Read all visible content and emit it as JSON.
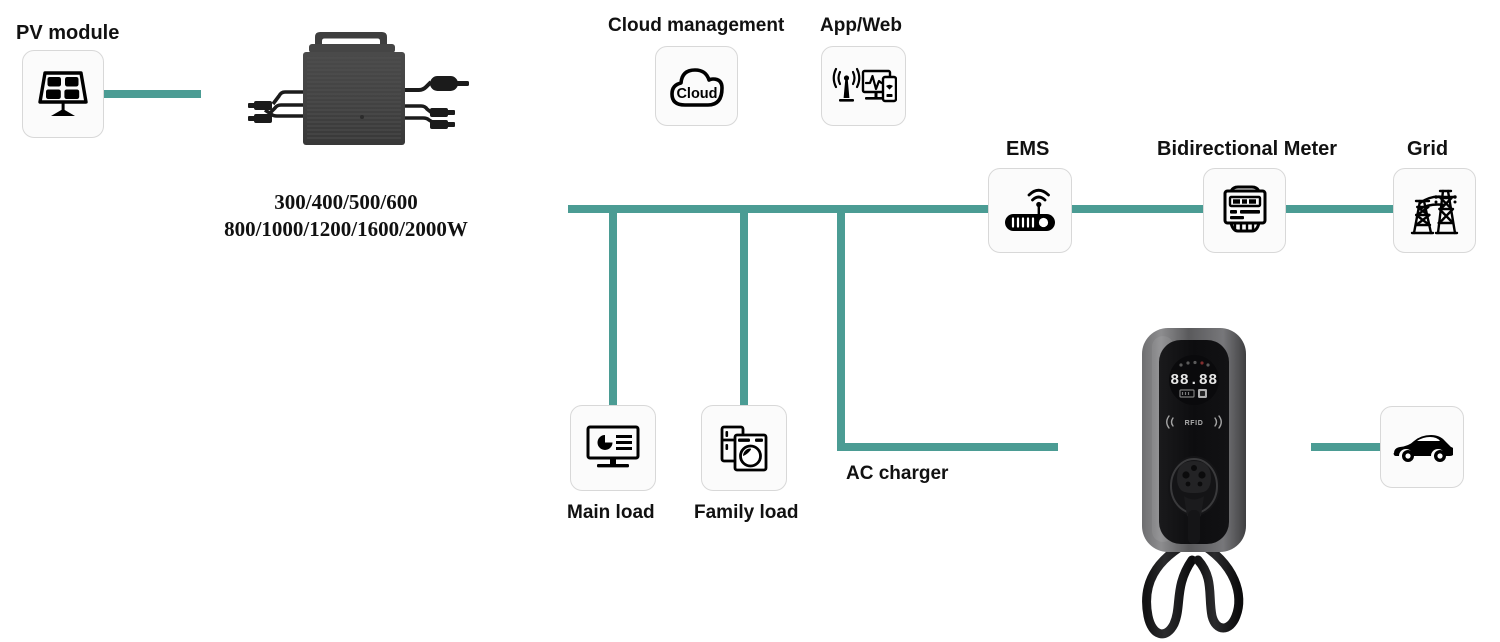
{
  "diagram": {
    "title": "Micro-inverter PV and EV charging system overview",
    "accent_color": "#4b9c94",
    "tile_bg": "#fbfbfb",
    "tile_border": "#d8d8d8"
  },
  "nodes": {
    "pv_module": {
      "label": "PV module",
      "icon": "solar-panel-icon"
    },
    "microinverter": {
      "icon": "microinverter-device",
      "spec_line1": "300/400/500/600",
      "spec_line2": "800/1000/1200/1600/2000W"
    },
    "cloud_management": {
      "label": "Cloud management",
      "icon": "cloud-icon",
      "icon_text": "Cloud"
    },
    "app_web": {
      "label": "App/Web",
      "icon": "signal-monitor-phone-icon"
    },
    "ems": {
      "label": "EMS",
      "icon": "router-wifi-icon"
    },
    "bidirectional_meter": {
      "label": "Bidirectional Meter",
      "icon": "energy-meter-icon"
    },
    "grid": {
      "label": "Grid",
      "icon": "transmission-tower-icon"
    },
    "main_load": {
      "label": "Main load",
      "icon": "monitor-chart-icon"
    },
    "family_load": {
      "label": "Family load",
      "icon": "fridge-washer-icon"
    },
    "ac_charger": {
      "label": "AC charger",
      "icon": "ev-wallbox-charger",
      "display_value": "88.88",
      "rfid_text": "RFID"
    },
    "electric_vehicle": {
      "icon": "car-icon"
    }
  },
  "connections": [
    {
      "name": "pv-to-microinverter",
      "from": "pv_module",
      "to": "microinverter"
    },
    {
      "name": "main-bus",
      "from": "microinverter",
      "to": "ems"
    },
    {
      "name": "bus-to-main-load",
      "from": "main-bus",
      "to": "main_load"
    },
    {
      "name": "bus-to-family-load",
      "from": "main-bus",
      "to": "family_load"
    },
    {
      "name": "bus-to-ac-charger",
      "from": "main-bus",
      "to": "ac_charger"
    },
    {
      "name": "ems-to-meter",
      "from": "ems",
      "to": "bidirectional_meter"
    },
    {
      "name": "meter-to-grid",
      "from": "bidirectional_meter",
      "to": "grid"
    },
    {
      "name": "charger-to-vehicle",
      "from": "ac_charger",
      "to": "electric_vehicle"
    }
  ]
}
